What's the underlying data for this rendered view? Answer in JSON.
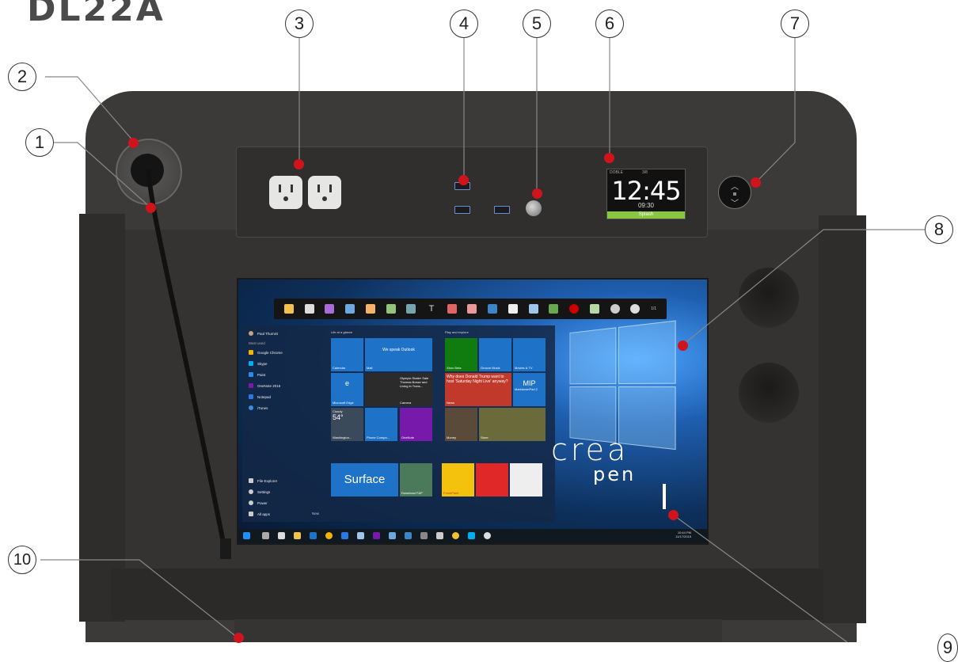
{
  "model_title": "DL22A",
  "callouts": [
    "1",
    "2",
    "3",
    "4",
    "5",
    "6",
    "7",
    "8",
    "9",
    "10"
  ],
  "clock": {
    "top_left": "DOBLE",
    "top_mid": "3/8",
    "time": "12:45",
    "sub": "09:30",
    "bar": "Splash"
  },
  "brand": {
    "crea": "crea",
    "pen": "pen"
  },
  "screen": {
    "user": "Paul Thurrott",
    "most_used": "Most used",
    "apps": [
      "Google Chrome",
      "Skype",
      "Paint",
      "OneNote 2016",
      "Notepad",
      "iTunes"
    ],
    "bottom_items": [
      "File Explorer",
      "Settings",
      "Power",
      "All apps"
    ],
    "new_label": "New",
    "group1": "Life at a glance",
    "group2": "Play and explore",
    "tiles": {
      "calendar": "Calendar",
      "mail": "Mail",
      "we_speak": "We speak Outlook",
      "edge": "Microsoft Edge",
      "news_headline": "Olympic Skater Sale Thomas Bosse and Living in Trans...",
      "camera": "Camera",
      "weather_label": "Cloudy",
      "weather_temp": "54°",
      "weather_city": "Washington...",
      "phone": "Phone Compa...",
      "onenote": "OneNote",
      "xbox": "Xbox Beta",
      "groove": "Groove Music",
      "movies": "Movies & TV",
      "trump": "Why does Donald Trump want to host 'Saturday Night Live' anyway?",
      "news": "News",
      "mip": "MIP",
      "mip_sub": "MarkdownPad 2",
      "money": "Money",
      "store": "Store",
      "surface": "Surface",
      "download": "Download F&P",
      "fresh": "FreshPaint"
    },
    "clock_small": "10:44 PM",
    "date_small": "11/17/2015",
    "toolbar_page": "1/1"
  },
  "colors": {
    "callout_dot": "#d0141c",
    "cabinet": "#3b3a38",
    "clock_bar": "#8cc63f"
  }
}
